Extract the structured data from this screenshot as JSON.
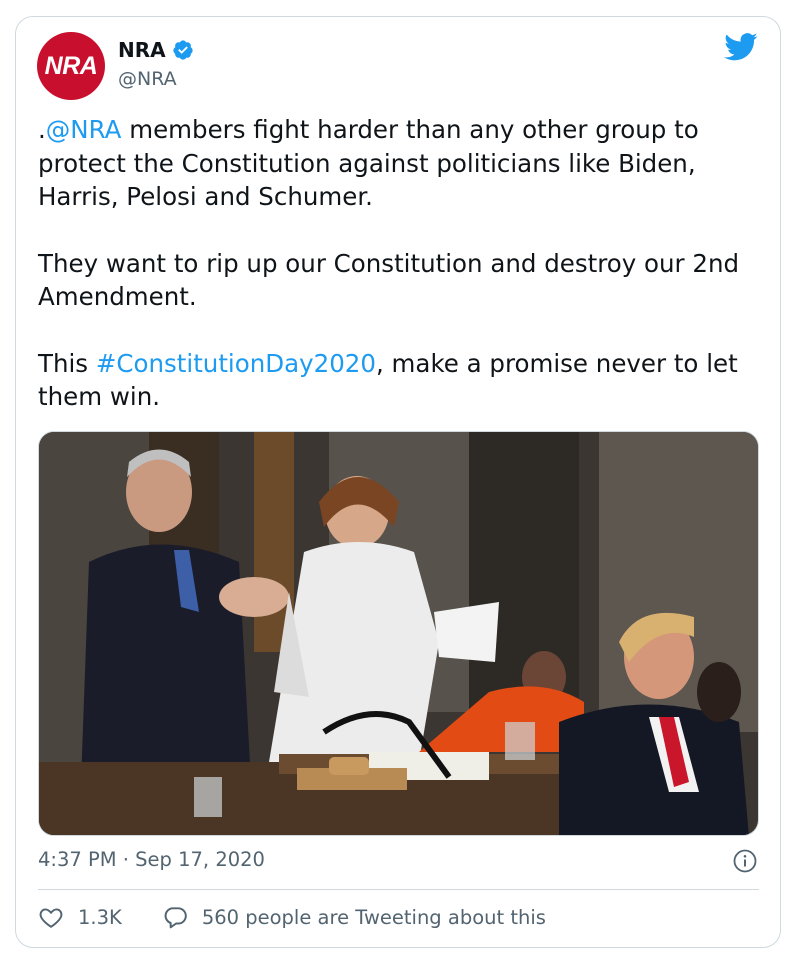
{
  "account": {
    "logo_text": "NRA",
    "name": "NRA",
    "handle": "@NRA",
    "verified_icon": "verified-badge-icon"
  },
  "tweet": {
    "line1_prefix": ".",
    "mention": "@NRA",
    "line1_rest": " members fight harder than any other group to protect the Constitution against politicians like Biden, Harris, Pelosi and Schumer.",
    "paragraph2": "They want to rip up our Constitution and destroy our 2nd Amendment.",
    "p3_prefix": "This ",
    "hashtag": "#ConstitutionDay2020",
    "p3_rest": ", make a promise never to let them win."
  },
  "meta": {
    "timestamp": "4:37 PM · Sep 17, 2020"
  },
  "actions": {
    "likes": "1.3K",
    "conversation": "560 people are Tweeting about this"
  },
  "colors": {
    "link": "#1d9bf0",
    "avatar_bg": "#c8102e",
    "muted": "#536471"
  }
}
